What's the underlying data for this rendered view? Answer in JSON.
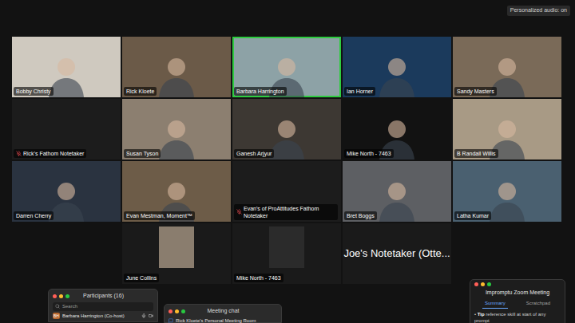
{
  "status": {
    "personalized_audio": "Personalized audio: on"
  },
  "gallery": {
    "rows": [
      {
        "tiles": [
          {
            "name": "Bobby Christy",
            "kind": "camera",
            "speaking": false,
            "muted": false,
            "color": "#cfc9bf"
          },
          {
            "name": "Rick Kloete",
            "kind": "camera",
            "speaking": false,
            "muted": false,
            "color": "#6b5a48"
          },
          {
            "name": "Barbara Harrington",
            "kind": "camera",
            "speaking": true,
            "muted": false,
            "color": "#8da2a6"
          },
          {
            "name": "Ian Horner",
            "kind": "camera",
            "speaking": false,
            "muted": false,
            "color": "#1b3a5c"
          },
          {
            "name": "Sandy Masters",
            "kind": "camera",
            "speaking": false,
            "muted": false,
            "color": "#7a6a58"
          }
        ]
      },
      {
        "tiles": [
          {
            "name": "Rick's Fathom Notetaker",
            "kind": "bot",
            "speaking": false,
            "muted": true,
            "color": "#1c1c1c"
          },
          {
            "name": "Susan Tyson",
            "kind": "camera",
            "speaking": false,
            "muted": false,
            "color": "#8c7f70"
          },
          {
            "name": "Ganesh Arjyur",
            "kind": "camera",
            "speaking": false,
            "muted": false,
            "color": "#3d3833"
          },
          {
            "name": "Mike North - 7463",
            "kind": "camera",
            "speaking": false,
            "muted": false,
            "color": "#121212"
          },
          {
            "name": "B Randall Willis",
            "kind": "camera",
            "speaking": false,
            "muted": false,
            "color": "#a89a85"
          }
        ]
      },
      {
        "tiles": [
          {
            "name": "Darren Cherry",
            "kind": "camera",
            "speaking": false,
            "muted": false,
            "color": "#2a3340"
          },
          {
            "name": "Evan Mestman, Moment™",
            "kind": "camera",
            "speaking": false,
            "muted": false,
            "color": "#6d5c48"
          },
          {
            "name": "Evan's of ProAttitudes Fathom Notetaker",
            "kind": "bot",
            "speaking": false,
            "muted": true,
            "color": "#1c1c1c"
          },
          {
            "name": "Bret Boggs",
            "kind": "camera",
            "speaking": false,
            "muted": false,
            "color": "#5d5f63"
          },
          {
            "name": "Latha Kumar",
            "kind": "camera",
            "speaking": false,
            "muted": false,
            "color": "#4a6070"
          }
        ]
      },
      {
        "tiles": [
          {
            "name": "June Collins",
            "kind": "avatar",
            "speaking": false,
            "muted": false,
            "color": "#8a7d6e"
          },
          {
            "name": "Mike North - 7463",
            "kind": "avatar",
            "speaking": false,
            "muted": false,
            "color": "#2b2b2b"
          },
          {
            "name": "Joe's Notetaker (Otte...",
            "kind": "name",
            "speaking": false,
            "muted": false,
            "color": "#1a1a1a"
          }
        ]
      }
    ]
  },
  "participants_panel": {
    "title": "Participants (16)",
    "search": {
      "placeholder": "Search"
    },
    "rows": [
      {
        "initials": "BH",
        "name": "Barbara Harrington (Co-host)"
      }
    ]
  },
  "chat_window": {
    "title": "Meeting chat",
    "room": "Rick Kloete's Personal Meeting Room"
  },
  "notes_panel": {
    "title": "Impromptu Zoom Meeting",
    "tabs": [
      {
        "label": "Summary",
        "selected": true
      },
      {
        "label": "Scratchpad",
        "selected": false
      }
    ],
    "tip": {
      "label": "Tip",
      "text": "reference skill at start of any prompt"
    }
  }
}
